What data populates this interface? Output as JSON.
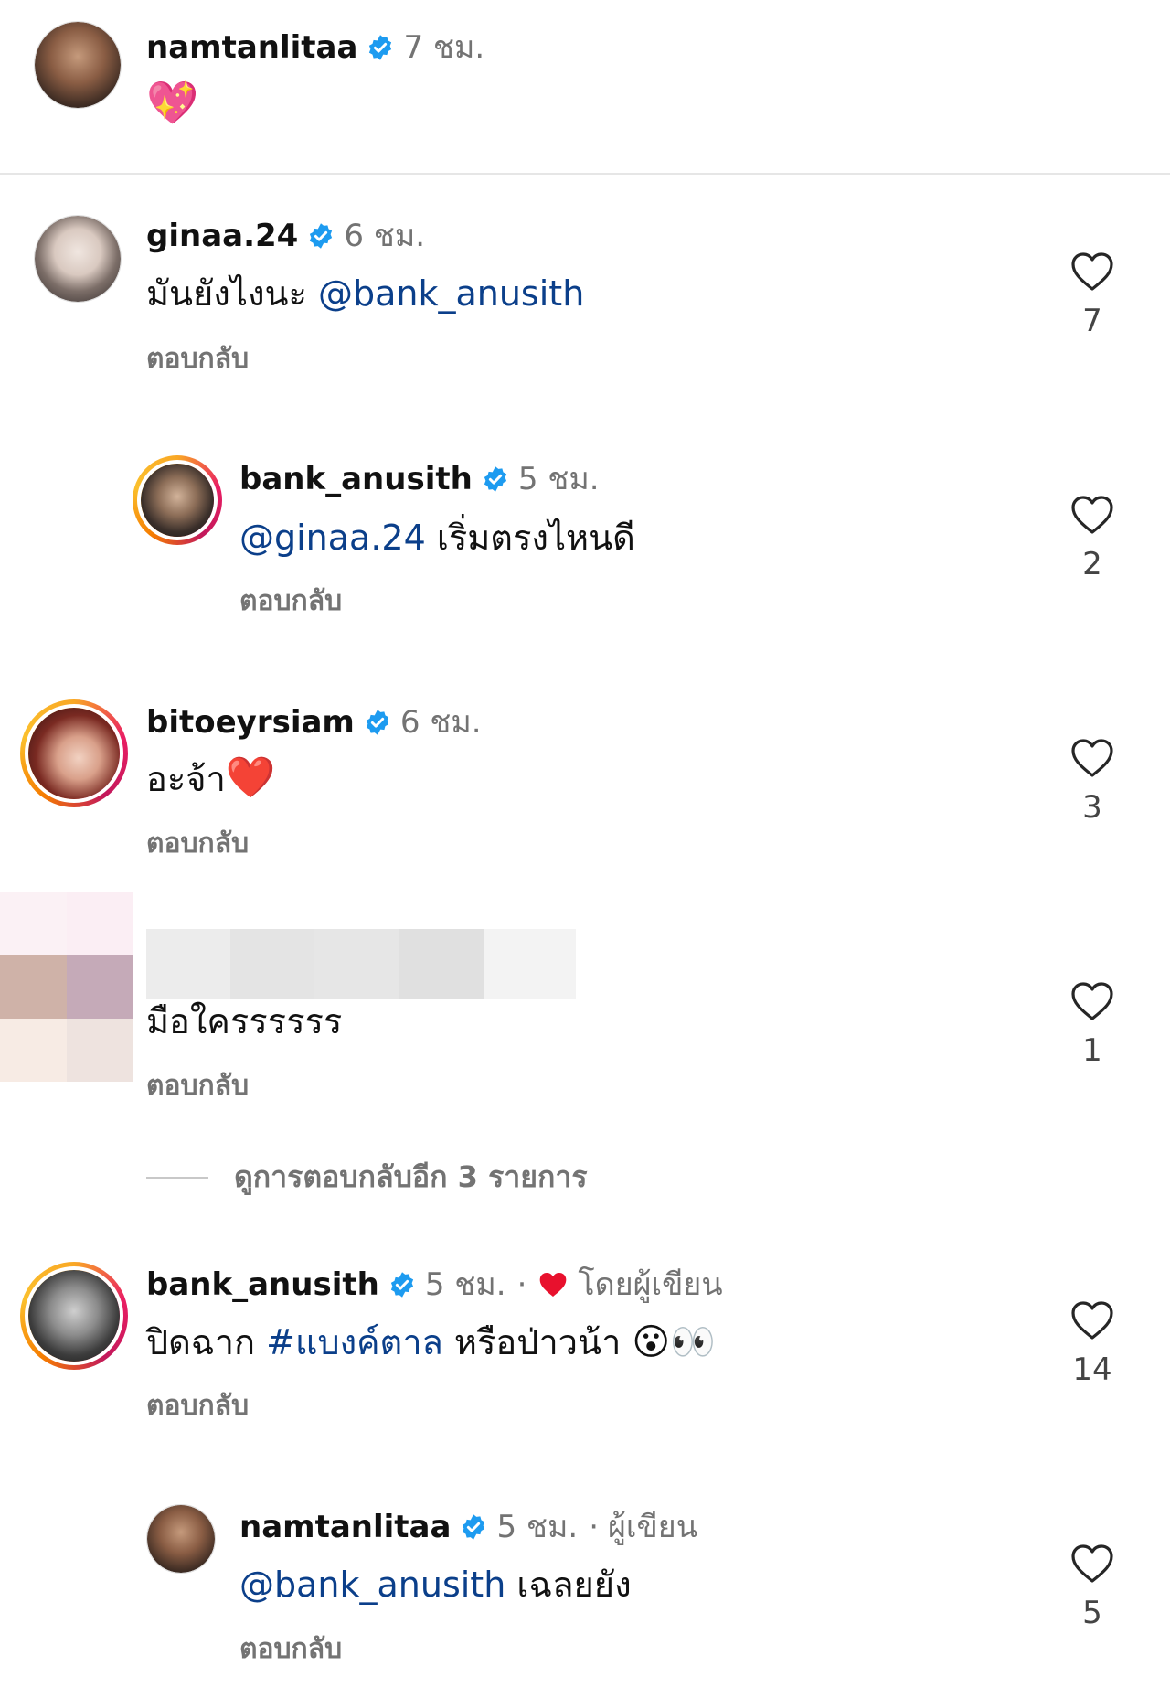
{
  "caption": {
    "username": "namtanlitaa",
    "time": "7 ชม.",
    "emoji": "💖"
  },
  "comments": [
    {
      "username": "ginaa.24",
      "time": "6 ชม.",
      "text_prefix": "มันยังไงนะ ",
      "mention": "@bank_anusith",
      "text_suffix": "",
      "reply_label": "ตอบกลับ",
      "likes": "7"
    },
    {
      "username": "bank_anusith",
      "time": "5 ชม.",
      "mention": "@ginaa.24",
      "text_suffix": " เริ่มตรงไหนดี",
      "reply_label": "ตอบกลับ",
      "likes": "2"
    },
    {
      "username": "bitoeyrsiam",
      "time": "6 ชม.",
      "text_prefix": "อะจ้า",
      "emoji": "❤️",
      "reply_label": "ตอบกลับ",
      "likes": "3"
    },
    {
      "username": "",
      "text_prefix": "มือใครรรรรร",
      "reply_label": "ตอบกลับ",
      "likes": "1"
    },
    {
      "username": "bank_anusith",
      "time": "5 ชม.",
      "separator": "·",
      "author_label": "โดยผู้เขียน",
      "text_prefix": "ปิดฉาก ",
      "hashtag": "#แบงค์ตาล",
      "text_suffix": " หรือป่าวน้า",
      "emoji": "😮👀",
      "reply_label": "ตอบกลับ",
      "likes": "14"
    },
    {
      "username": "namtanlitaa",
      "time": "5 ชม.",
      "separator": "·",
      "author_label": "ผู้เขียน",
      "mention": "@bank_anusith",
      "text_suffix": " เฉลยยัง",
      "reply_label": "ตอบกลับ",
      "likes": "5"
    }
  ],
  "view_more_replies": "ดูการตอบกลับอีก 3 รายการ",
  "colors": {
    "mention": "#0b3f8a",
    "muted": "#737373",
    "verified": "#1d9bf0",
    "heart": "#e8112d"
  }
}
